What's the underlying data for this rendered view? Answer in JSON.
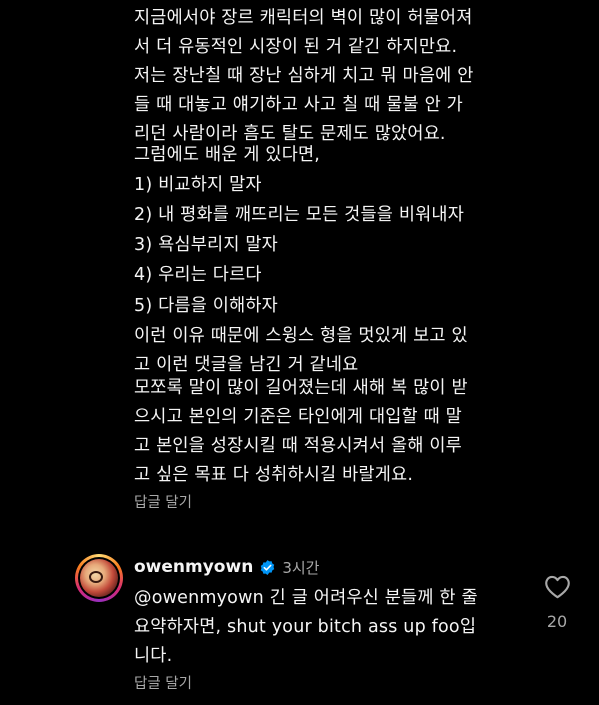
{
  "first_comment": {
    "paragraphs": [
      "지금에서야 장르 캐릭터의 벽이 많이 허물어져\n서 더 유동적인 시장이 된 거 같긴 하지만요.",
      "저는 장난칠 때 장난 심하게 치고 뭐 마음에 안\n들 때 대놓고 얘기하고 사고 칠 때 물불 안 가\n리던 사람이라 흠도 탈도 문제도 많았어요.",
      "그럼에도 배운 게 있다면,",
      "1) 비교하지 말자",
      "2) 내 평화를 깨뜨리는 모든 것들을 비워내자",
      "3) 욕심부리지 말자",
      "4) 우리는 다르다",
      "5) 다름을 이해하자",
      "이런 이유 때문에 스윙스 형을 멋있게 보고 있\n고 이런 댓글을 남긴 거 같네요",
      "모쪼록 말이 많이 길어졌는데 새해 복 많이 받\n으시고 본인의 기준은 타인에게 대입할 때 말\n고 본인을 성장시킬 때 적용시켜서 올해 이루\n고 싶은 목표 다 성취하시길 바랄게요."
    ],
    "reply_label": "답글 달기"
  },
  "reply_comment": {
    "username": "owenmyown",
    "timestamp": "3시간",
    "text": "@owenmyown 긴 글 어려우신 분들께 한 줄\n요약하자면, shut your bitch ass up foo입\n니다.",
    "reply_label": "답글 달기",
    "like_count": "20",
    "verified_badge_icon": "verified-badge-icon",
    "heart_icon": "heart-outline-icon"
  },
  "colors": {
    "background": "#000000",
    "text_primary": "#f5f5f5",
    "text_secondary": "#a8a8a8",
    "verified_blue": "#0095f6"
  }
}
